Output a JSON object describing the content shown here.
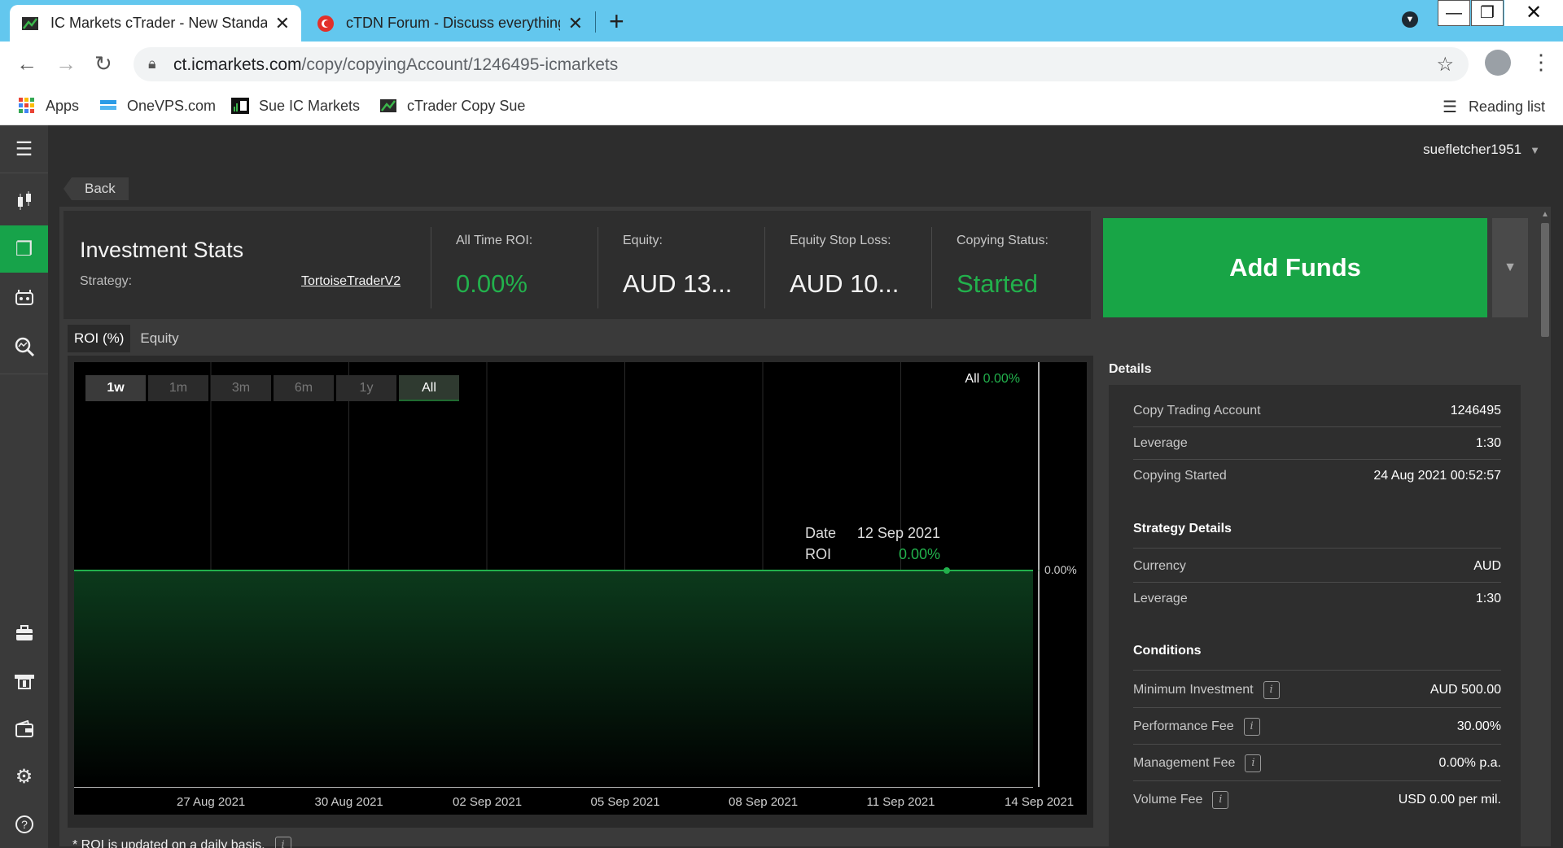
{
  "browser": {
    "tabs": [
      {
        "title": "IC Markets cTrader - New Standa",
        "active": true
      },
      {
        "title": "cTDN Forum - Discuss everything",
        "active": false
      }
    ],
    "url_domain": "ct.icmarkets.com",
    "url_path": "/copy/copyingAccount/1246495-icmarkets",
    "bookmarks": [
      "Apps",
      "OneVPS.com",
      "Sue IC Markets",
      "cTrader Copy Sue"
    ],
    "reading_list": "Reading list"
  },
  "app": {
    "username": "suefletcher1951",
    "back_label": "Back",
    "stats": {
      "title": "Investment Stats",
      "strategy_label": "Strategy:",
      "strategy_value": "TortoiseTraderV2",
      "roi_label": "All Time ROI:",
      "roi_value": "0.00%",
      "equity_label": "Equity:",
      "equity_value": "AUD 13...",
      "stoploss_label": "Equity Stop Loss:",
      "stoploss_value": "AUD 10...",
      "status_label": "Copying Status:",
      "status_value": "Started"
    },
    "add_funds_label": "Add Funds",
    "chart_tabs": [
      "ROI (%)",
      "Equity"
    ],
    "range_buttons": [
      "1w",
      "1m",
      "3m",
      "6m",
      "1y",
      "All"
    ],
    "legend_label": "All",
    "legend_value": "0.00%",
    "tooltip": {
      "date_label": "Date",
      "date_value": "12 Sep 2021",
      "roi_label": "ROI",
      "roi_value": "0.00%"
    },
    "footnote": "* ROI is updated on a daily basis.",
    "details": {
      "header": "Details",
      "rows": [
        {
          "k": "Copy Trading Account",
          "v": "1246495"
        },
        {
          "k": "Leverage",
          "v": "1:30"
        },
        {
          "k": "Copying Started",
          "v": "24 Aug 2021 00:52:57"
        }
      ],
      "strategy_section": "Strategy Details",
      "strategy_rows": [
        {
          "k": "Currency",
          "v": "AUD"
        },
        {
          "k": "Leverage",
          "v": "1:30"
        }
      ],
      "conditions_section": "Conditions",
      "condition_rows": [
        {
          "k": "Minimum Investment",
          "v": "AUD 500.00"
        },
        {
          "k": "Performance Fee",
          "v": "30.00%"
        },
        {
          "k": "Management Fee",
          "v": "0.00% p.a."
        },
        {
          "k": "Volume Fee",
          "v": "USD 0.00 per mil."
        }
      ]
    }
  },
  "colors": {
    "accent": "#18a546",
    "positive": "#22b14c",
    "chart_bg": "#000000"
  },
  "chart_data": {
    "type": "area",
    "x": [
      "27 Aug 2021",
      "30 Aug 2021",
      "02 Sep 2021",
      "05 Sep 2021",
      "08 Sep 2021",
      "11 Sep 2021",
      "14 Sep 2021"
    ],
    "y_tick_labels": [
      "0.00%"
    ],
    "series": [
      {
        "values": [
          0,
          0,
          0,
          0,
          0,
          0,
          0
        ]
      }
    ],
    "highlight_point": {
      "x": "12 Sep 2021",
      "y": "0.00%"
    }
  }
}
